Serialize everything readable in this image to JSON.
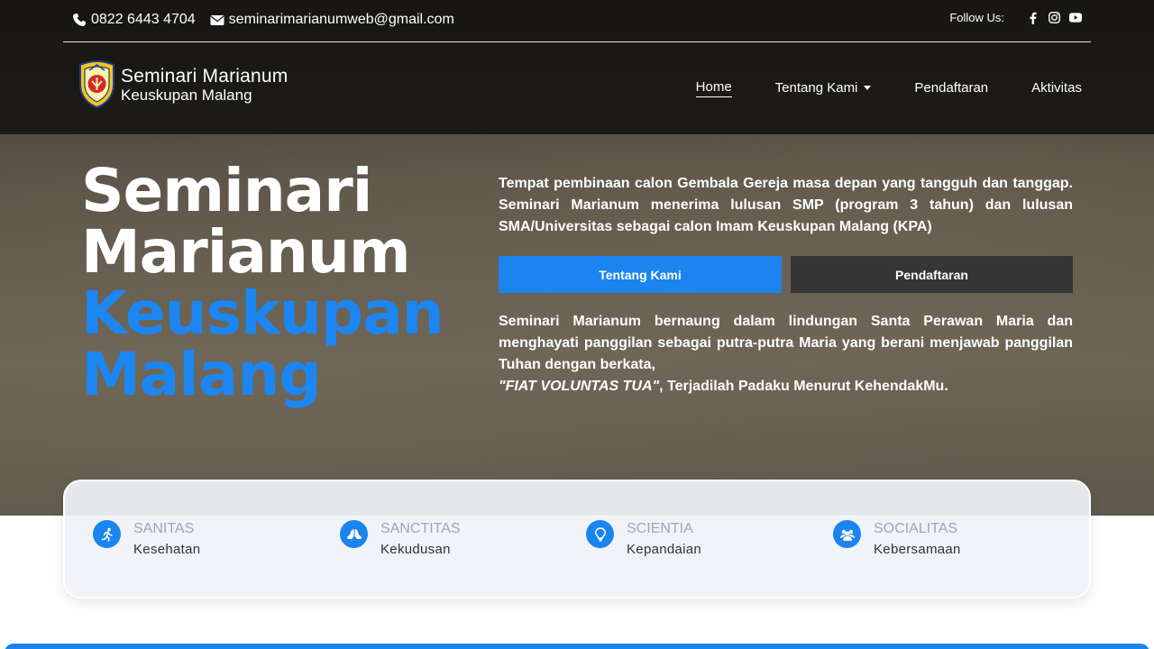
{
  "topbar": {
    "phone": "0822 6443 4704",
    "email": "seminarimarianumweb@gmail.com",
    "follow_label": "Follow Us:",
    "socials": [
      "facebook-icon",
      "instagram-icon",
      "youtube-icon"
    ]
  },
  "logo": {
    "line1": "Seminari Marianum",
    "line2": "Keuskupan Malang"
  },
  "nav": {
    "items": [
      {
        "label": "Home",
        "active": true
      },
      {
        "label": "Tentang Kami",
        "dropdown": true
      },
      {
        "label": "Pendaftaran"
      },
      {
        "label": "Aktivitas"
      }
    ]
  },
  "hero": {
    "title_line1": "Seminari",
    "title_line2": "Marianum",
    "title_line3": "Keuskupan",
    "title_line4": "Malang",
    "intro": "Tempat pembinaan calon Gembala Gereja masa depan yang tangguh dan tanggap. Seminari Marianum menerima lulusan SMP (program 3 tahun) dan lulusan SMA/Universitas sebagai calon Imam Keuskupan Malang (KPA)",
    "btn_primary": "Tentang Kami",
    "btn_secondary": "Pendaftaran",
    "body": "Seminari Marianum bernaung dalam lindungan Santa Perawan Maria dan menghayati panggilan sebagai putra-putra Maria yang berani menjawab panggilan Tuhan dengan berkata,",
    "motto": "\"FIAT VOLUNTAS TUA\"",
    "motto_rest": ", Terjadilah Padaku Menurut KehendakMu."
  },
  "features": [
    {
      "latin": "SANITAS",
      "label": "Kesehatan",
      "icon": "running-icon"
    },
    {
      "latin": "SANCTITAS",
      "label": "Kekudusan",
      "icon": "praying-hands-icon"
    },
    {
      "latin": "SCIENTIA",
      "label": "Kepandaian",
      "icon": "lightbulb-icon"
    },
    {
      "latin": "SOCIALITAS",
      "label": "Kebersamaan",
      "icon": "people-icon"
    }
  ],
  "colors": {
    "accent": "#1b84ee",
    "dark_button": "#363636",
    "header": "#1a1916"
  }
}
